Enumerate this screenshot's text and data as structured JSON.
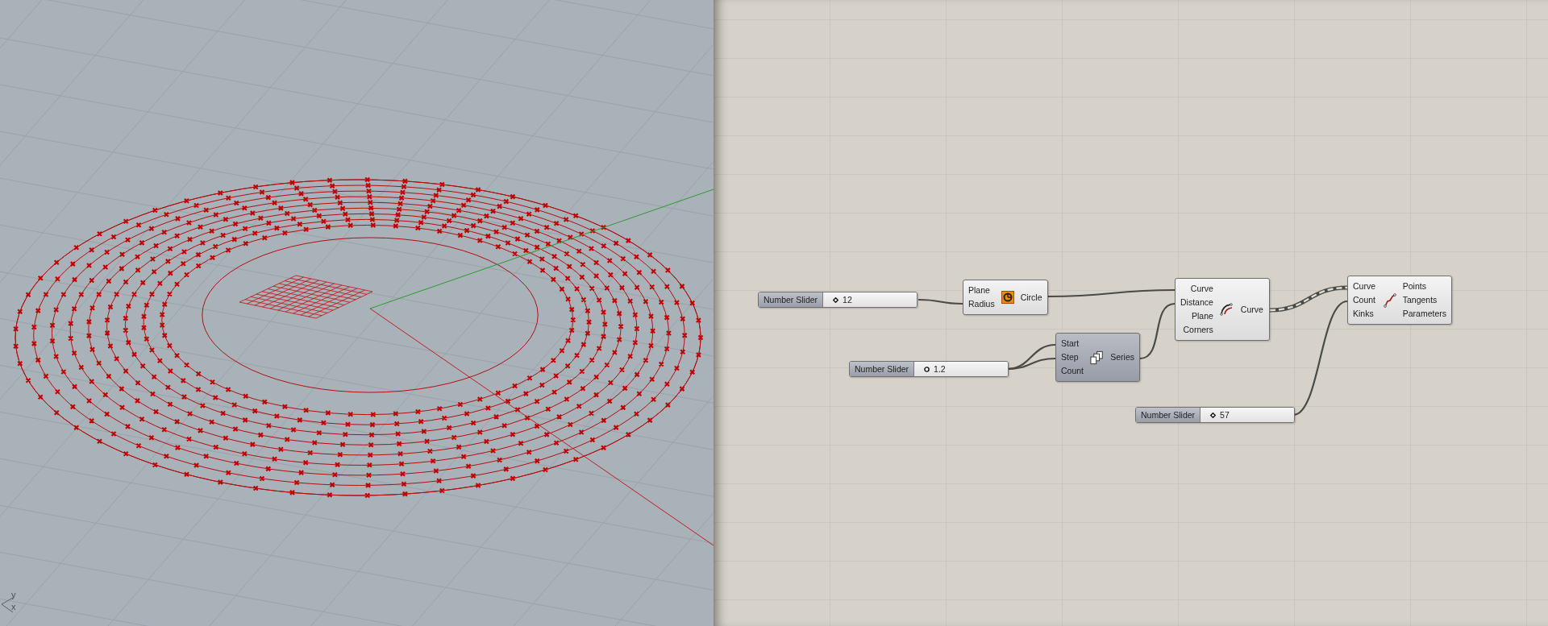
{
  "viewport": {
    "axis_labels": [
      "y",
      "x"
    ]
  },
  "canvas": {
    "nodes": [
      {
        "kind": "slider",
        "label": "Number Slider",
        "value": "12",
        "integer": true
      },
      {
        "kind": "component",
        "preview": true,
        "inputs": [
          "Plane",
          "Radius"
        ],
        "outputs": [
          "Circle"
        ]
      },
      {
        "kind": "component",
        "preview": true,
        "inputs": [
          "Curve",
          "Distance",
          "Plane",
          "Corners"
        ],
        "outputs": [
          "Curve"
        ]
      },
      {
        "kind": "component",
        "preview": true,
        "inputs": [
          "Curve",
          "Count",
          "Kinks"
        ],
        "outputs": [
          "Points",
          "Tangents",
          "Parameters"
        ]
      },
      {
        "kind": "slider",
        "label": "Number Slider",
        "value": "1.2",
        "integer": false
      },
      {
        "kind": "component",
        "preview": false,
        "inputs": [
          "Start",
          "Step",
          "Count"
        ],
        "outputs": [
          "Series"
        ]
      },
      {
        "kind": "slider",
        "label": "Number Slider",
        "value": "57",
        "integer": true
      }
    ]
  }
}
